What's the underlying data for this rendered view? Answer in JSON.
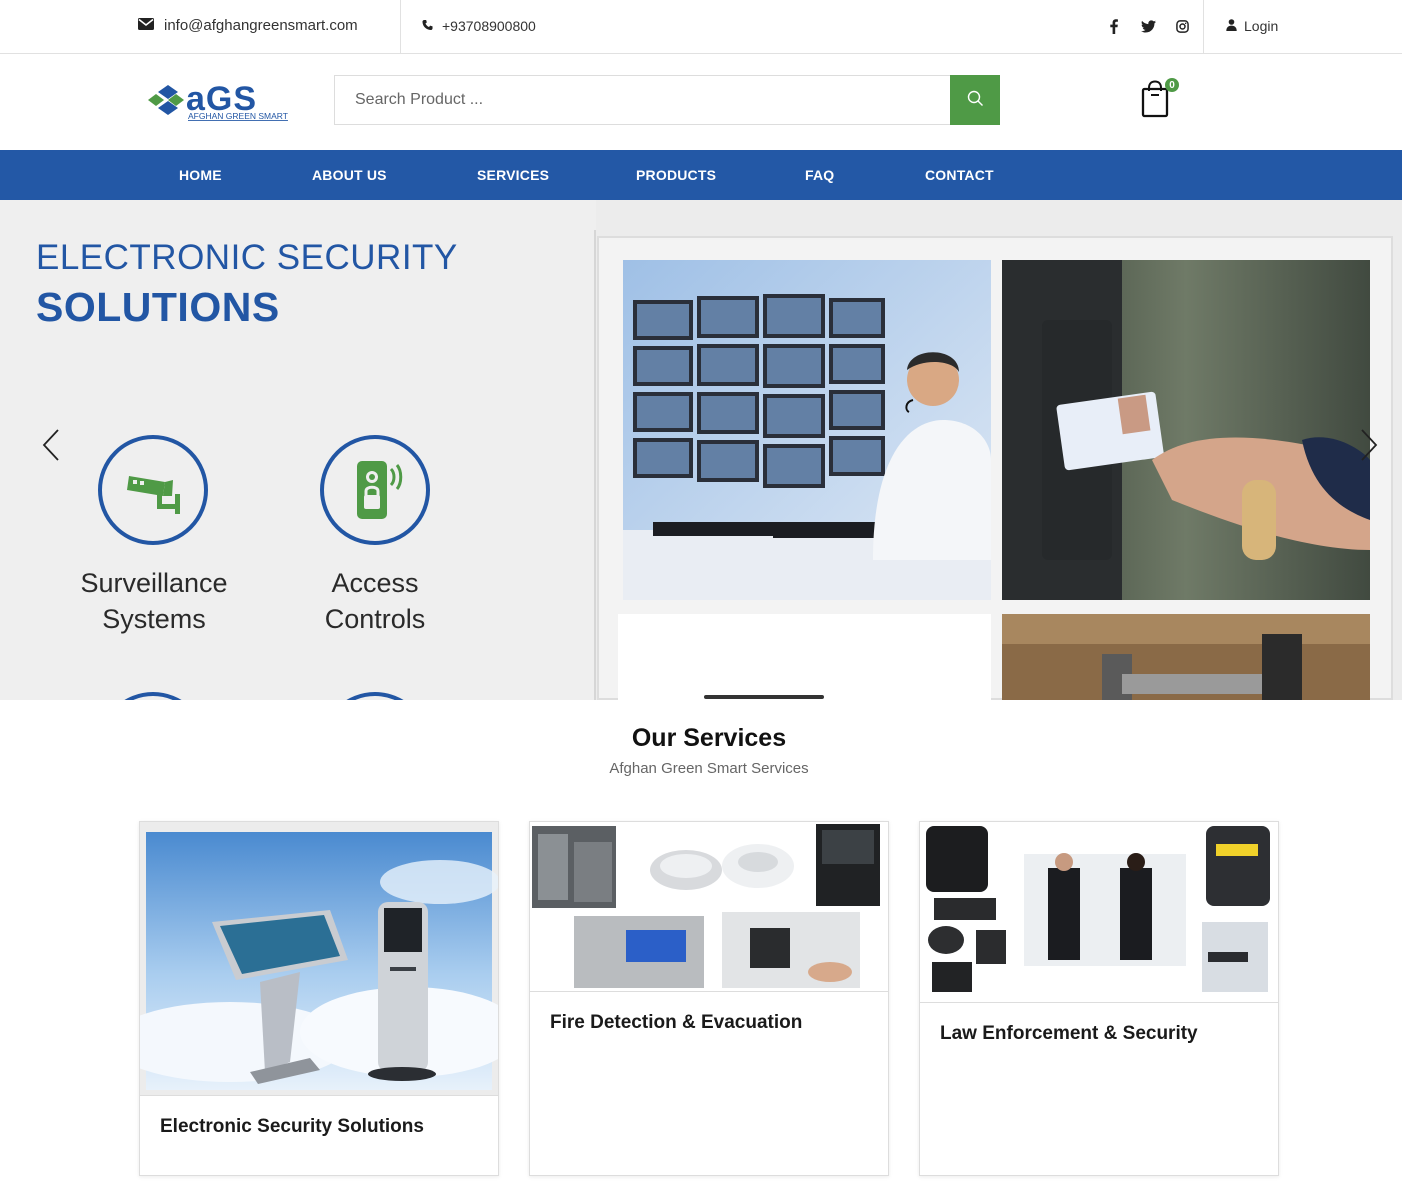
{
  "topbar": {
    "email": "info@afghangreensmart.com",
    "phone": "+93708900800",
    "login": "Login",
    "social_icons": [
      "facebook-icon",
      "twitter-icon",
      "instagram-icon"
    ]
  },
  "header": {
    "logo_text": "aGS",
    "logo_subtext": "AFGHAN GREEN SMART",
    "search_placeholder": "Search Product ...",
    "cart_count": "0"
  },
  "nav": {
    "items": [
      {
        "label": "HOME"
      },
      {
        "label": "ABOUT US"
      },
      {
        "label": "SERVICES"
      },
      {
        "label": "PRODUCTS"
      },
      {
        "label": "FAQ"
      },
      {
        "label": "CONTACT"
      }
    ]
  },
  "hero": {
    "title_line1": "ELECTRONIC SECURITY",
    "title_line2": "SOLUTIONS",
    "features": [
      {
        "line1": "Surveillance",
        "line2": "Systems",
        "icon": "cctv-camera-icon"
      },
      {
        "line1": "Access",
        "line2": "Controls",
        "icon": "access-control-icon"
      }
    ]
  },
  "services": {
    "title": "Our Services",
    "subtitle": "Afghan Green Smart Services",
    "cards": [
      {
        "title": "Electronic Security Solutions"
      },
      {
        "title": "Fire Detection & Evacuation"
      },
      {
        "title": "Law Enforcement & Security"
      }
    ]
  },
  "colors": {
    "brand_blue": "#2358a6",
    "brand_green": "#4f9a46"
  }
}
